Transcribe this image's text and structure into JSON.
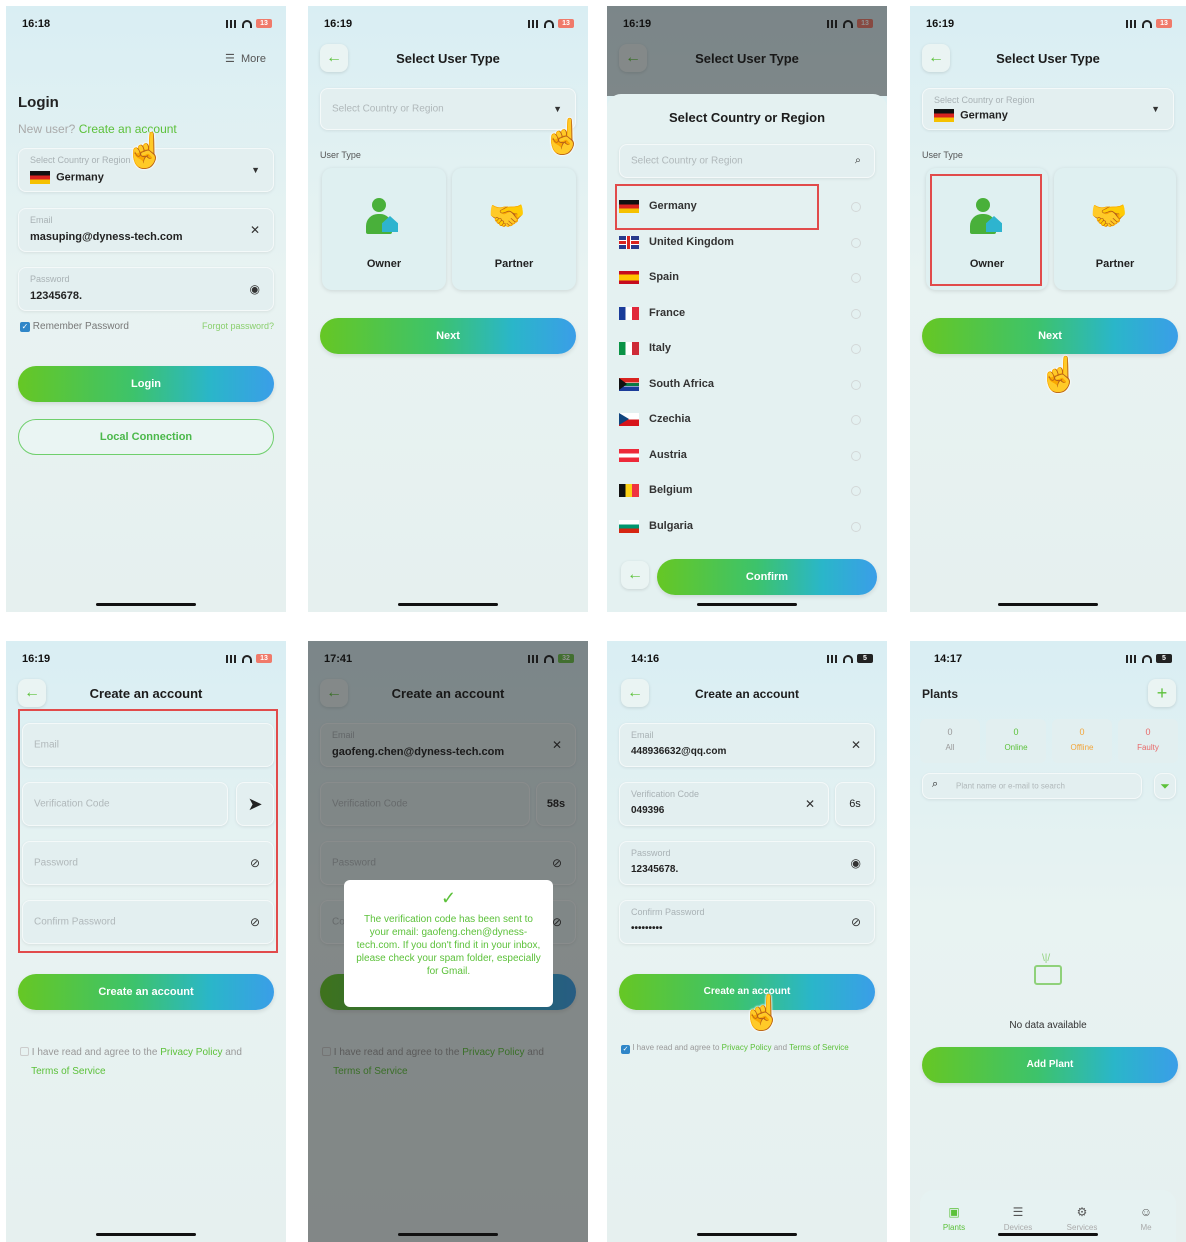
{
  "colors": {
    "brand_green": "#5cc13a",
    "accent_blue": "#3a9ee8",
    "highlight_red": "#e14b4b"
  },
  "p1": {
    "time": "16:18",
    "battery": "13",
    "more": "More",
    "title": "Login",
    "new_user": "New user?",
    "create_link": "Create an account",
    "country_label": "Select Country or Region",
    "country_value": "Germany",
    "email_label": "Email",
    "email_value": "masuping@dyness-tech.com",
    "password_label": "Password",
    "password_value": "12345678.",
    "remember": "Remember Password",
    "forgot": "Forgot password?",
    "login": "Login",
    "local": "Local Connection"
  },
  "p2": {
    "time": "16:19",
    "battery": "13",
    "title": "Select User Type",
    "country_placeholder": "Select Country or Region",
    "user_type": "User Type",
    "owner": "Owner",
    "partner": "Partner",
    "next": "Next"
  },
  "p3": {
    "time": "16:19",
    "battery": "13",
    "title": "Select User Type",
    "sheet_title": "Select Country or Region",
    "search_placeholder": "Select Country or Region",
    "countries": [
      {
        "name": "Germany",
        "flag": "de"
      },
      {
        "name": "United Kingdom",
        "flag": "gb"
      },
      {
        "name": "Spain",
        "flag": "es"
      },
      {
        "name": "France",
        "flag": "fr"
      },
      {
        "name": "Italy",
        "flag": "it"
      },
      {
        "name": "South Africa",
        "flag": "za"
      },
      {
        "name": "Czechia",
        "flag": "cz"
      },
      {
        "name": "Austria",
        "flag": "at"
      },
      {
        "name": "Belgium",
        "flag": "be"
      },
      {
        "name": "Bulgaria",
        "flag": "bg"
      }
    ],
    "confirm": "Confirm"
  },
  "p4": {
    "time": "16:19",
    "battery": "13",
    "title": "Select User Type",
    "country_label": "Select Country or Region",
    "country_value": "Germany",
    "user_type": "User Type",
    "owner": "Owner",
    "partner": "Partner",
    "next": "Next"
  },
  "p5": {
    "time": "16:19",
    "battery": "13",
    "title": "Create an account",
    "email": "Email",
    "code": "Verification Code",
    "password": "Password",
    "confirm_password": "Confirm Password",
    "create": "Create an account",
    "agree": "I have read and agree to the",
    "privacy": "Privacy Policy",
    "and": "and",
    "terms": "Terms of Service"
  },
  "p6": {
    "time": "17:41",
    "battery": "32",
    "title": "Create an account",
    "email_label": "Email",
    "email_value": "gaofeng.chen@dyness-tech.com",
    "code": "Verification Code",
    "countdown": "58s",
    "password": "Password",
    "confirm_prefix": "Co",
    "dialog": "The verification code has been sent to your email: gaofeng.chen@dyness-tech.com. If you don't find it in your inbox, please check your spam folder, especially for Gmail.",
    "agree": "I have read and agree to the",
    "privacy": "Privacy Policy",
    "and": "and",
    "terms": "Terms of Service"
  },
  "p7": {
    "time": "14:16",
    "battery": "5",
    "title": "Create an account",
    "email_label": "Email",
    "email_value": "448936632@qq.com",
    "code_label": "Verification Code",
    "code_value": "049396",
    "countdown": "6s",
    "password_label": "Password",
    "password_value": "12345678.",
    "confirm_label": "Confirm Password",
    "confirm_value": "•••••••••",
    "create": "Create an account",
    "agree": "I have read and agree to",
    "privacy": "Privacy Policy",
    "and": "and",
    "terms": "Terms of Service"
  },
  "p8": {
    "time": "14:17",
    "battery": "5",
    "title": "Plants",
    "stats": [
      {
        "n": "0",
        "l": "All"
      },
      {
        "n": "0",
        "l": "Online"
      },
      {
        "n": "0",
        "l": "Offline"
      },
      {
        "n": "0",
        "l": "Faulty"
      }
    ],
    "search_placeholder": "Plant name or e-mail to search",
    "empty": "No data available",
    "add_plant": "Add Plant",
    "tabs": [
      "Plants",
      "Devices",
      "Services",
      "Me"
    ]
  }
}
